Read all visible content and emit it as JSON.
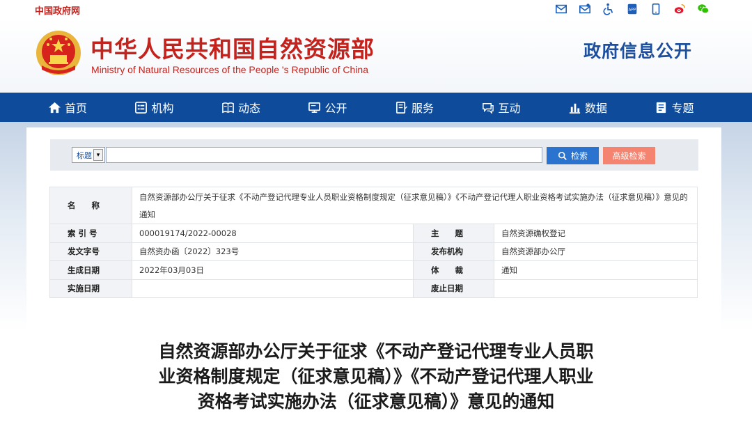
{
  "topbar": {
    "gov_link": "中国政府网",
    "icons": [
      "mail-icon",
      "mailbox-icon",
      "accessibility-icon",
      "app-icon",
      "mobile-icon",
      "weibo-icon",
      "wechat-icon"
    ],
    "app_label": "APP"
  },
  "header": {
    "title": "中华人民共和国自然资源部",
    "subtitle": "Ministry of Natural Resources of the People 's Republic of China",
    "section": "政府信息公开"
  },
  "nav": {
    "items": [
      {
        "label": "首页",
        "icon": "home-icon"
      },
      {
        "label": "机构",
        "icon": "institution-icon"
      },
      {
        "label": "动态",
        "icon": "news-icon"
      },
      {
        "label": "公开",
        "icon": "disclosure-icon"
      },
      {
        "label": "服务",
        "icon": "service-icon"
      },
      {
        "label": "互动",
        "icon": "interaction-icon"
      },
      {
        "label": "数据",
        "icon": "data-icon"
      },
      {
        "label": "专题",
        "icon": "topic-icon"
      }
    ]
  },
  "search": {
    "scope_selected": "标题",
    "input_value": "",
    "search_label": "检索",
    "advanced_label": "高级检索"
  },
  "meta": {
    "name_label": "名　　称",
    "name_value": "自然资源部办公厅关于征求《不动产登记代理专业人员职业资格制度规定（征求意见稿）》《不动产登记代理人职业资格考试实施办法（征求意见稿）》意见的通知",
    "index_label": "索 引 号",
    "index_value": "000019174/2022-00028",
    "subject_label": "主　　题",
    "subject_value": "自然资源确权登记",
    "docno_label": "发文字号",
    "docno_value": "自然资办函〔2022〕323号",
    "issuer_label": "发布机构",
    "issuer_value": "自然资源部办公厅",
    "date_label": "生成日期",
    "date_value": "2022年03月03日",
    "genre_label": "体　　裁",
    "genre_value": "通知",
    "effective_label": "实施日期",
    "effective_value": "",
    "expiry_label": "废止日期",
    "expiry_value": ""
  },
  "article": {
    "title": "自然资源部办公厅关于征求《不动产登记代理专业人员职业资格制度规定（征求意见稿）》《不动产登记代理人职业资格考试实施办法（征求意见稿）》意见的通知"
  },
  "colors": {
    "brand_red": "#c4221c",
    "nav_blue": "#0e4b9b",
    "search_blue": "#2a74cf",
    "advanced_salmon": "#f4836f"
  }
}
